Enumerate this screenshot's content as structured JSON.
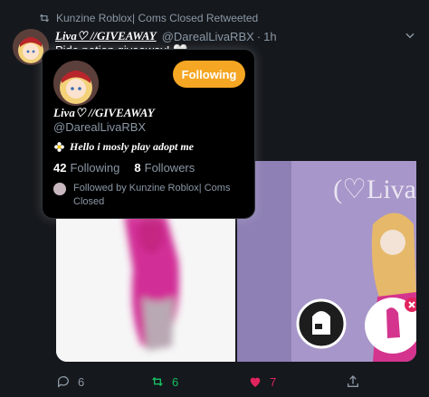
{
  "retweet_header": {
    "text": "Kunzine Roblox| Coms Closed Retweeted",
    "icon": "retweet-icon"
  },
  "tweet": {
    "display_name": "Liva♡ //GIVEAWAY",
    "handle": "@DarealLivaRBX",
    "separator": "·",
    "time": "1h",
    "text": "Pide potion giveaway! 🤍",
    "image_right_watermark": "(♡Liva"
  },
  "actions": {
    "reply_count": "6",
    "retweet_count": "6",
    "like_count": "7"
  },
  "hover_card": {
    "follow_button": "Following",
    "display_name": "Liva♡ //GIVEAWAY",
    "handle": "@DarealLivaRBX",
    "bio": "Hello i mosly play adopt me",
    "following_count": "42",
    "following_label": "Following",
    "followers_count": "8",
    "followers_label": "Followers",
    "followed_by": "Followed by Kunzine Roblox| Coms Closed"
  },
  "colors": {
    "background": "#15181c",
    "follow_button": "#f5a623",
    "retweet_green": "#17bf63",
    "like_red": "#e0245e"
  }
}
